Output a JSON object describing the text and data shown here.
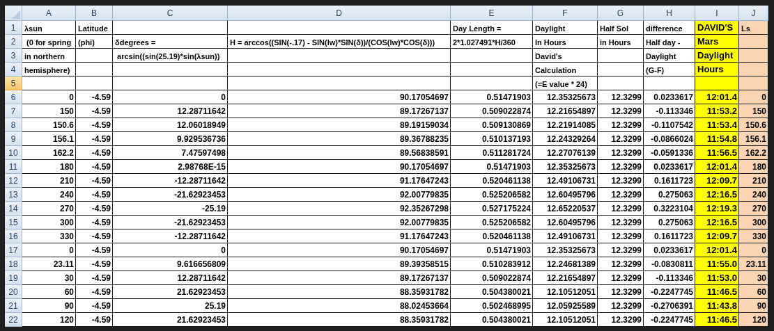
{
  "columns": [
    {
      "label": "A"
    },
    {
      "label": "B"
    },
    {
      "label": "C"
    },
    {
      "label": "D"
    },
    {
      "label": "E"
    },
    {
      "label": "F"
    },
    {
      "label": "G"
    },
    {
      "label": "H"
    },
    {
      "label": "I",
      "color": "#ffff00",
      "large": true
    },
    {
      "label": "J",
      "color": "#fcd5b4"
    }
  ],
  "rows": [
    {
      "number": "1",
      "selected": false,
      "kind": "text",
      "cells": [
        "λsun",
        "Latitude",
        null,
        null,
        "Day Length =",
        "Daylight",
        "Half Sol",
        "difference",
        "DAVID'S",
        "Ls"
      ]
    },
    {
      "number": "2",
      "selected": false,
      "kind": "text",
      "cells": [
        " (0 for spring",
        "(phi)",
        "δdegrees =",
        "H = arccos((SIN(-.17) - SIN(lw)*SIN(δ))/(COS(lw)*COS(δ)))",
        "2*1.027491*H/360",
        "In Hours",
        "in Hours",
        "Half day -",
        "Mars",
        null
      ]
    },
    {
      "number": "3",
      "selected": false,
      "kind": "text",
      "cells": [
        "in northern",
        null,
        " arcsin((sin(25.19)*sin(λsun))",
        null,
        null,
        "David's",
        null,
        "Daylight",
        "Daylight",
        null
      ]
    },
    {
      "number": "4",
      "selected": false,
      "kind": "text",
      "cells": [
        "hemisphere)",
        null,
        null,
        null,
        null,
        "Calculation",
        null,
        "(G-F)",
        "Hours",
        null
      ]
    },
    {
      "number": "5",
      "selected": true,
      "kind": "text",
      "cells": [
        null,
        null,
        null,
        null,
        null,
        "(=E value * 24)",
        null,
        null,
        null,
        null
      ]
    },
    {
      "number": "6",
      "selected": false,
      "kind": "value",
      "cells": [
        "0",
        "-4.59",
        "0",
        "90.17054697",
        "0.51471903",
        "12.35325673",
        "12.3299",
        "0.0233617",
        "12:01.4",
        "0"
      ]
    },
    {
      "number": "7",
      "selected": false,
      "kind": "value",
      "cells": [
        "150",
        "-4.59",
        "12.28711642",
        "89.17267137",
        "0.509022874",
        "12.21654897",
        "12.3299",
        "-0.113346",
        "11:53.2",
        "150"
      ]
    },
    {
      "number": "8",
      "selected": false,
      "kind": "value",
      "cells": [
        "150.6",
        "-4.59",
        "12.06018949",
        "89.19159034",
        "0.509130869",
        "12.21914085",
        "12.3299",
        "-0.1107542",
        "11:53.4",
        "150.6"
      ]
    },
    {
      "number": "9",
      "selected": false,
      "kind": "value",
      "cells": [
        "156.1",
        "-4.59",
        "9.929536736",
        "89.36788235",
        "0.510137193",
        "12.24329264",
        "12.3299",
        "-0.0866024",
        "11:54.8",
        "156.1"
      ]
    },
    {
      "number": "10",
      "selected": false,
      "kind": "value",
      "cells": [
        "162.2",
        "-4.59",
        "7.47597498",
        "89.56838591",
        "0.511281724",
        "12.27076139",
        "12.3299",
        "-0.0591336",
        "11:56.5",
        "162.2"
      ]
    },
    {
      "number": "11",
      "selected": false,
      "kind": "value",
      "cells": [
        "180",
        "-4.59",
        "2.98768E-15",
        "90.17054697",
        "0.51471903",
        "12.35325673",
        "12.3299",
        "0.0233617",
        "12:01.4",
        "180"
      ]
    },
    {
      "number": "12",
      "selected": false,
      "kind": "value",
      "cells": [
        "210",
        "-4.59",
        "-12.28711642",
        "91.17647243",
        "0.520461138",
        "12.49106731",
        "12.3299",
        "0.1611723",
        "12:09.7",
        "210"
      ]
    },
    {
      "number": "13",
      "selected": false,
      "kind": "value",
      "cells": [
        "240",
        "-4.59",
        "-21.62923453",
        "92.00779835",
        "0.525206582",
        "12.60495796",
        "12.3299",
        "0.275063",
        "12:16.5",
        "240"
      ]
    },
    {
      "number": "14",
      "selected": false,
      "kind": "value",
      "cells": [
        "270",
        "-4.59",
        "-25.19",
        "92.35267298",
        "0.527175224",
        "12.65220537",
        "12.3299",
        "0.3223104",
        "12:19.3",
        "270"
      ]
    },
    {
      "number": "15",
      "selected": false,
      "kind": "value",
      "cells": [
        "300",
        "-4.59",
        "-21.62923453",
        "92.00779835",
        "0.525206582",
        "12.60495796",
        "12.3299",
        "0.275063",
        "12:16.5",
        "300"
      ]
    },
    {
      "number": "16",
      "selected": false,
      "kind": "value",
      "cells": [
        "330",
        "-4.59",
        "-12.28711642",
        "91.17647243",
        "0.520461138",
        "12.49106731",
        "12.3299",
        "0.1611723",
        "12:09.7",
        "330"
      ]
    },
    {
      "number": "17",
      "selected": false,
      "kind": "value",
      "cells": [
        "0",
        "-4.59",
        "0",
        "90.17054697",
        "0.51471903",
        "12.35325673",
        "12.3299",
        "0.0233617",
        "12:01.4",
        "0"
      ]
    },
    {
      "number": "18",
      "selected": false,
      "kind": "value",
      "cells": [
        "23.11",
        "-4.59",
        "9.616656809",
        "89.39358515",
        "0.510283912",
        "12.24681389",
        "12.3299",
        "-0.0830811",
        "11:55.0",
        "23.11"
      ]
    },
    {
      "number": "19",
      "selected": false,
      "kind": "value",
      "cells": [
        "30",
        "-4.59",
        "12.28711642",
        "89.17267137",
        "0.509022874",
        "12.21654897",
        "12.3299",
        "-0.113346",
        "11:53.0",
        "30"
      ]
    },
    {
      "number": "20",
      "selected": false,
      "kind": "value",
      "cells": [
        "60",
        "-4.59",
        "21.62923453",
        "88.35931782",
        "0.504380021",
        "12.10512051",
        "12.3299",
        "-0.2247745",
        "11:46.5",
        "60"
      ]
    },
    {
      "number": "21",
      "selected": false,
      "kind": "value",
      "cells": [
        "90",
        "-4.59",
        "25.19",
        "88.02453664",
        "0.502468995",
        "12.05925589",
        "12.3299",
        "-0.2706391",
        "11:43.8",
        "90"
      ]
    },
    {
      "number": "22",
      "selected": false,
      "kind": "value",
      "cells": [
        "120",
        "-4.59",
        "21.62923453",
        "88.35931782",
        "0.504380021",
        "12.10512051",
        "12.3299",
        "-0.2247745",
        "11:46.5",
        "120"
      ]
    }
  ]
}
